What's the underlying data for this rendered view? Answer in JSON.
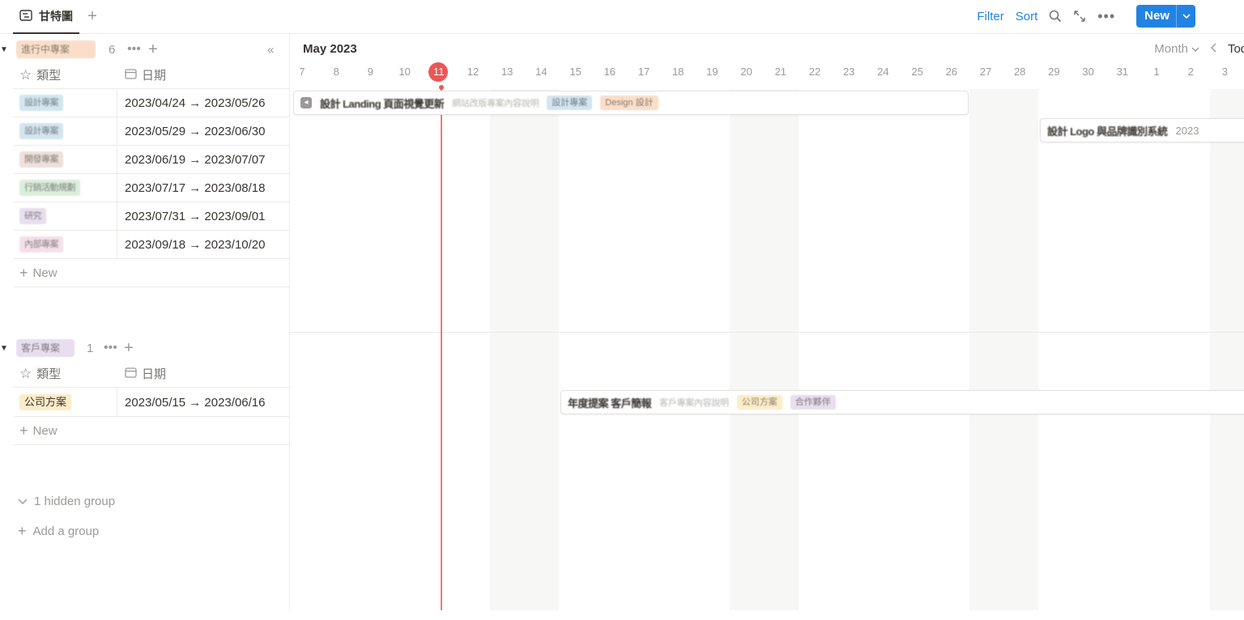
{
  "tab": {
    "label": "甘特圖",
    "icon": "timeline-icon"
  },
  "toolbar": {
    "filter": "Filter",
    "sort": "Sort",
    "new_label": "New"
  },
  "timeline": {
    "month_label": "May 2023",
    "view_label": "Month",
    "today_label": "Today",
    "today_day": "11",
    "days": [
      "7",
      "8",
      "9",
      "10",
      "11",
      "12",
      "13",
      "14",
      "15",
      "16",
      "17",
      "18",
      "19",
      "20",
      "21",
      "22",
      "23",
      "24",
      "25",
      "26",
      "27",
      "28",
      "29",
      "30",
      "31",
      "1",
      "2",
      "3"
    ]
  },
  "columns": {
    "type": "類型",
    "date": "日期"
  },
  "groups": [
    {
      "tag": "進行中專案",
      "tag_color": "#fadec9",
      "count": "6",
      "rows": [
        {
          "type": "設計專案",
          "type_color": "#d3e5ef",
          "date": "2023/04/24 → 2023/05/26"
        },
        {
          "type": "設計專案",
          "type_color": "#d3e5ef",
          "date": "2023/05/29 → 2023/06/30"
        },
        {
          "type": "開發專案",
          "type_color": "#eee0da",
          "date": "2023/06/19 → 2023/07/07"
        },
        {
          "type": "行銷活動規劃",
          "type_color": "#dbeddb",
          "date": "2023/07/17 → 2023/08/18"
        },
        {
          "type": "研究",
          "type_color": "#e8deee",
          "date": "2023/07/31 → 2023/09/01"
        },
        {
          "type": "內部專案",
          "type_color": "#f5e0e9",
          "date": "2023/09/18 → 2023/10/20"
        }
      ],
      "new_label": "New"
    },
    {
      "tag": "客戶專案",
      "tag_color": "#e8deee",
      "count": "1",
      "rows": [
        {
          "type": "公司方案",
          "type_color": "#fdecc8",
          "date": "2023/05/15 → 2023/06/16"
        }
      ],
      "new_label": "New"
    }
  ],
  "bars": [
    {
      "title": "設計 Landing 頁面視覺更新",
      "subtitle": "網站改版專案內容說明",
      "tags": [
        {
          "label": "設計專案",
          "color": "#d3e5ef"
        },
        {
          "label": "Design 設計",
          "color": "#fadec9"
        }
      ],
      "date": ""
    },
    {
      "title": "設計 Logo 與品牌識別系統",
      "subtitle": "",
      "tags": [],
      "date": "2023"
    },
    {
      "title": "年度提案 客戶簡報",
      "subtitle": "客戶專案內容說明",
      "tags": [
        {
          "label": "公司方案",
          "color": "#fdecc8"
        },
        {
          "label": "合作夥伴",
          "color": "#e8deee"
        }
      ],
      "date": ""
    }
  ],
  "footer": {
    "hidden_groups": "1 hidden group",
    "add_group": "Add a group"
  },
  "colors": {
    "accent": "#2383e2",
    "today": "#eb5757"
  }
}
